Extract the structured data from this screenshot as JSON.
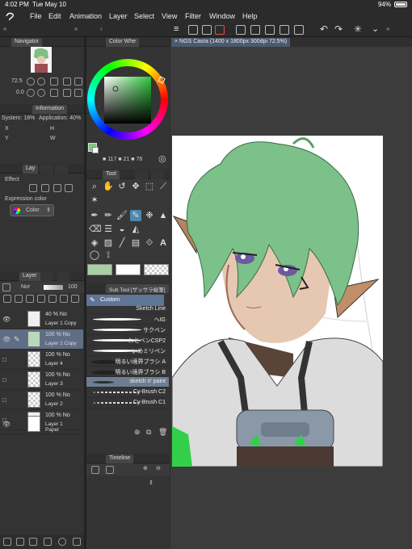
{
  "status": {
    "time": "4:02 PM",
    "date": "Tue May 10",
    "battery": "94%"
  },
  "menu": [
    "File",
    "Edit",
    "Animation",
    "Layer",
    "Select",
    "View",
    "Filter",
    "Window",
    "Help"
  ],
  "navigator": {
    "title": "Navigator",
    "zoom": "72.5",
    "rotation": "0.0"
  },
  "information": {
    "title": "Information",
    "system_label": "System:",
    "system_value": "18%",
    "app_label": "Application:",
    "app_value": "40%",
    "x": "X",
    "y": "Y",
    "h": "H",
    "w": "W"
  },
  "layer_prop": {
    "tab": "Lay",
    "effect_label": "Effect",
    "expr_label": "Expression color",
    "color_value": "Color"
  },
  "color_wheel": {
    "title": "Color Whe",
    "h": "117",
    "s": "21",
    "v": "76",
    "accent": "#7ec884"
  },
  "tool": {
    "title": "Tool"
  },
  "subtool": {
    "title": "Sub Tool [ザッサラ絵筆]",
    "group": "Custom",
    "items": [
      "Sketch Line",
      "ヘIG",
      "サクベン",
      "わとベンCSP2",
      "いめミリペン",
      "明るい境界ブラシ A",
      "明るい境界ブラシ B",
      "sketch n' paint",
      "Cy-Brush C2",
      "Cy-Brush C1"
    ]
  },
  "timeline": {
    "title": "Timeline"
  },
  "layer": {
    "title": "Layer",
    "blend": "Nor",
    "opacity": "100",
    "rows": [
      {
        "pct": "40 % No",
        "name": "Layer 1 Copy",
        "selected": false
      },
      {
        "pct": "100 % No",
        "name": "Layer 1 Copy",
        "selected": true
      },
      {
        "pct": "100 % No",
        "name": "Layer 4",
        "selected": false
      },
      {
        "pct": "100 % No",
        "name": "Layer 3",
        "selected": false
      },
      {
        "pct": "100 % No",
        "name": "Layer 2",
        "selected": false
      },
      {
        "pct": "100 % No",
        "name": "Layer 1",
        "selected": false
      },
      {
        "pct": "",
        "name": "Paper",
        "selected": false
      }
    ]
  },
  "canvas": {
    "tab": "NGS Casra (1400 x 1800px 300dpi 72.5%)"
  }
}
